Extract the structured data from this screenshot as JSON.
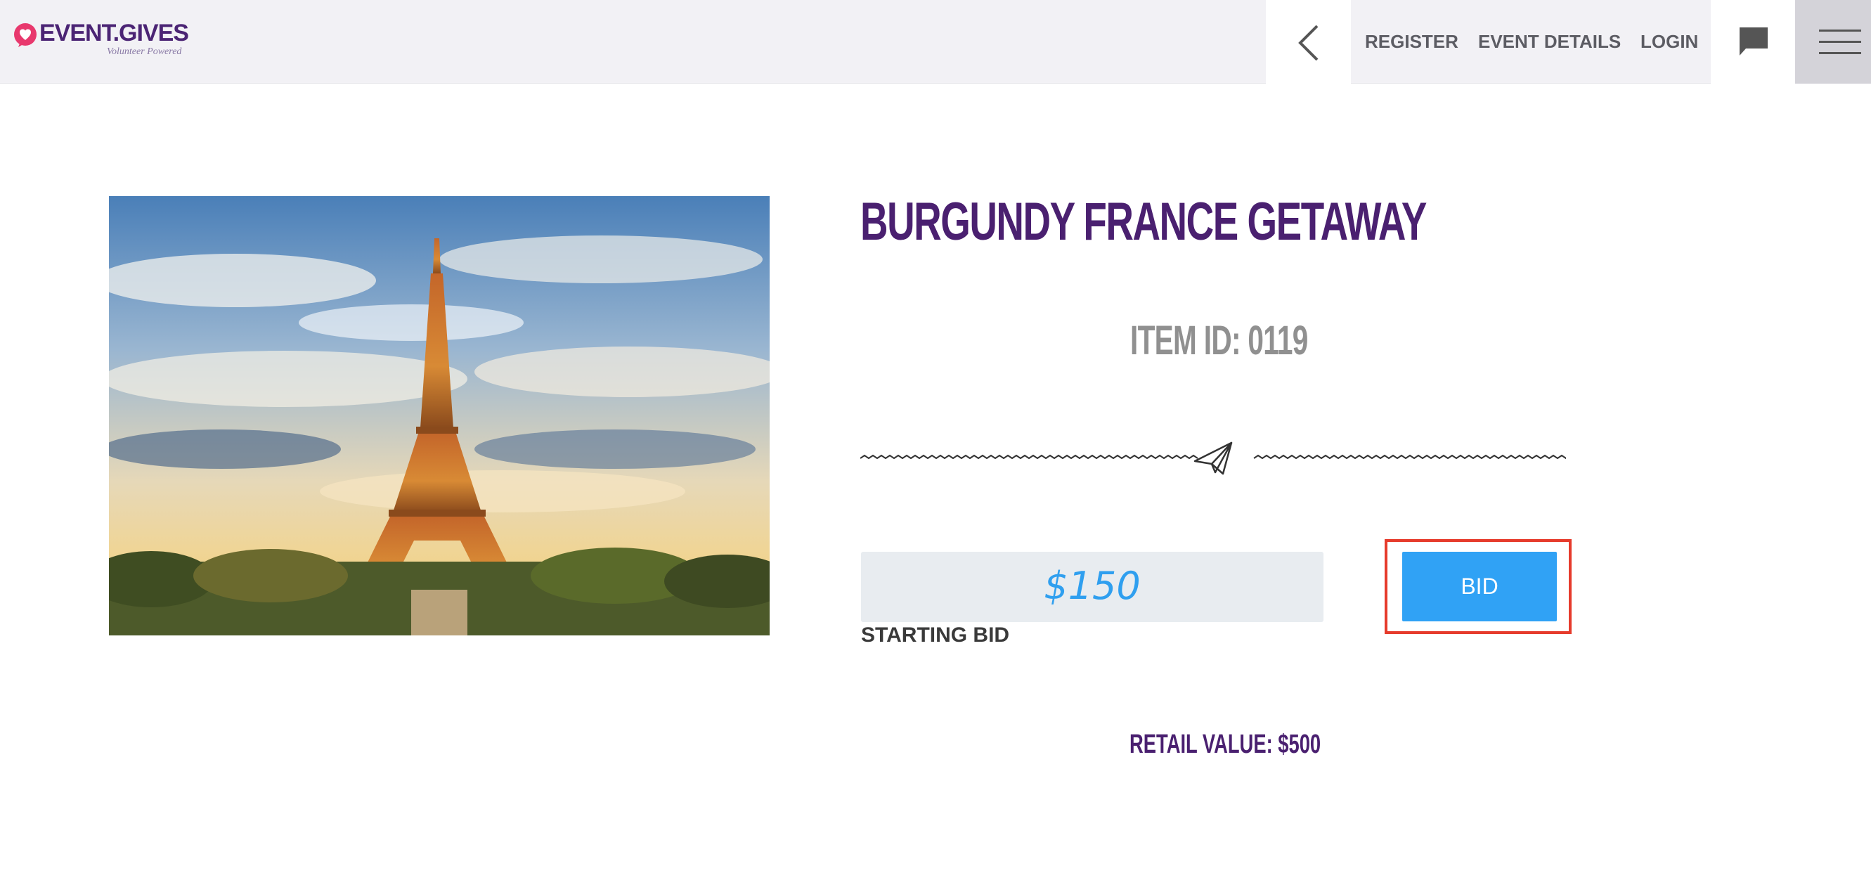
{
  "header": {
    "logo_text": "EVENT.GIVES",
    "logo_tagline": "Volunteer Powered",
    "nav": {
      "register": "REGISTER",
      "event_details": "EVENT DETAILS",
      "login": "LOGIN"
    },
    "icons": {
      "back": "chevron-left-icon",
      "chat": "chat-bubble-icon",
      "menu": "hamburger-menu-icon",
      "logo": "heart-bubble-icon"
    }
  },
  "item": {
    "title": "BURGUNDY FRANCE GETAWAY",
    "item_id": "ITEM ID: 0119",
    "divider_icon": "paper-plane-icon",
    "starting_bid_amount": "$150",
    "starting_bid_label": "STARTING BID",
    "bid_button": "BID",
    "retail_value": "RETAIL VALUE: $500"
  },
  "colors": {
    "brand_purple": "#4a2070",
    "logo_pink": "#e8386d",
    "bid_blue": "#30a2f5",
    "highlight_red": "#e63b2c",
    "topbar_bg": "#f2f1f5"
  }
}
